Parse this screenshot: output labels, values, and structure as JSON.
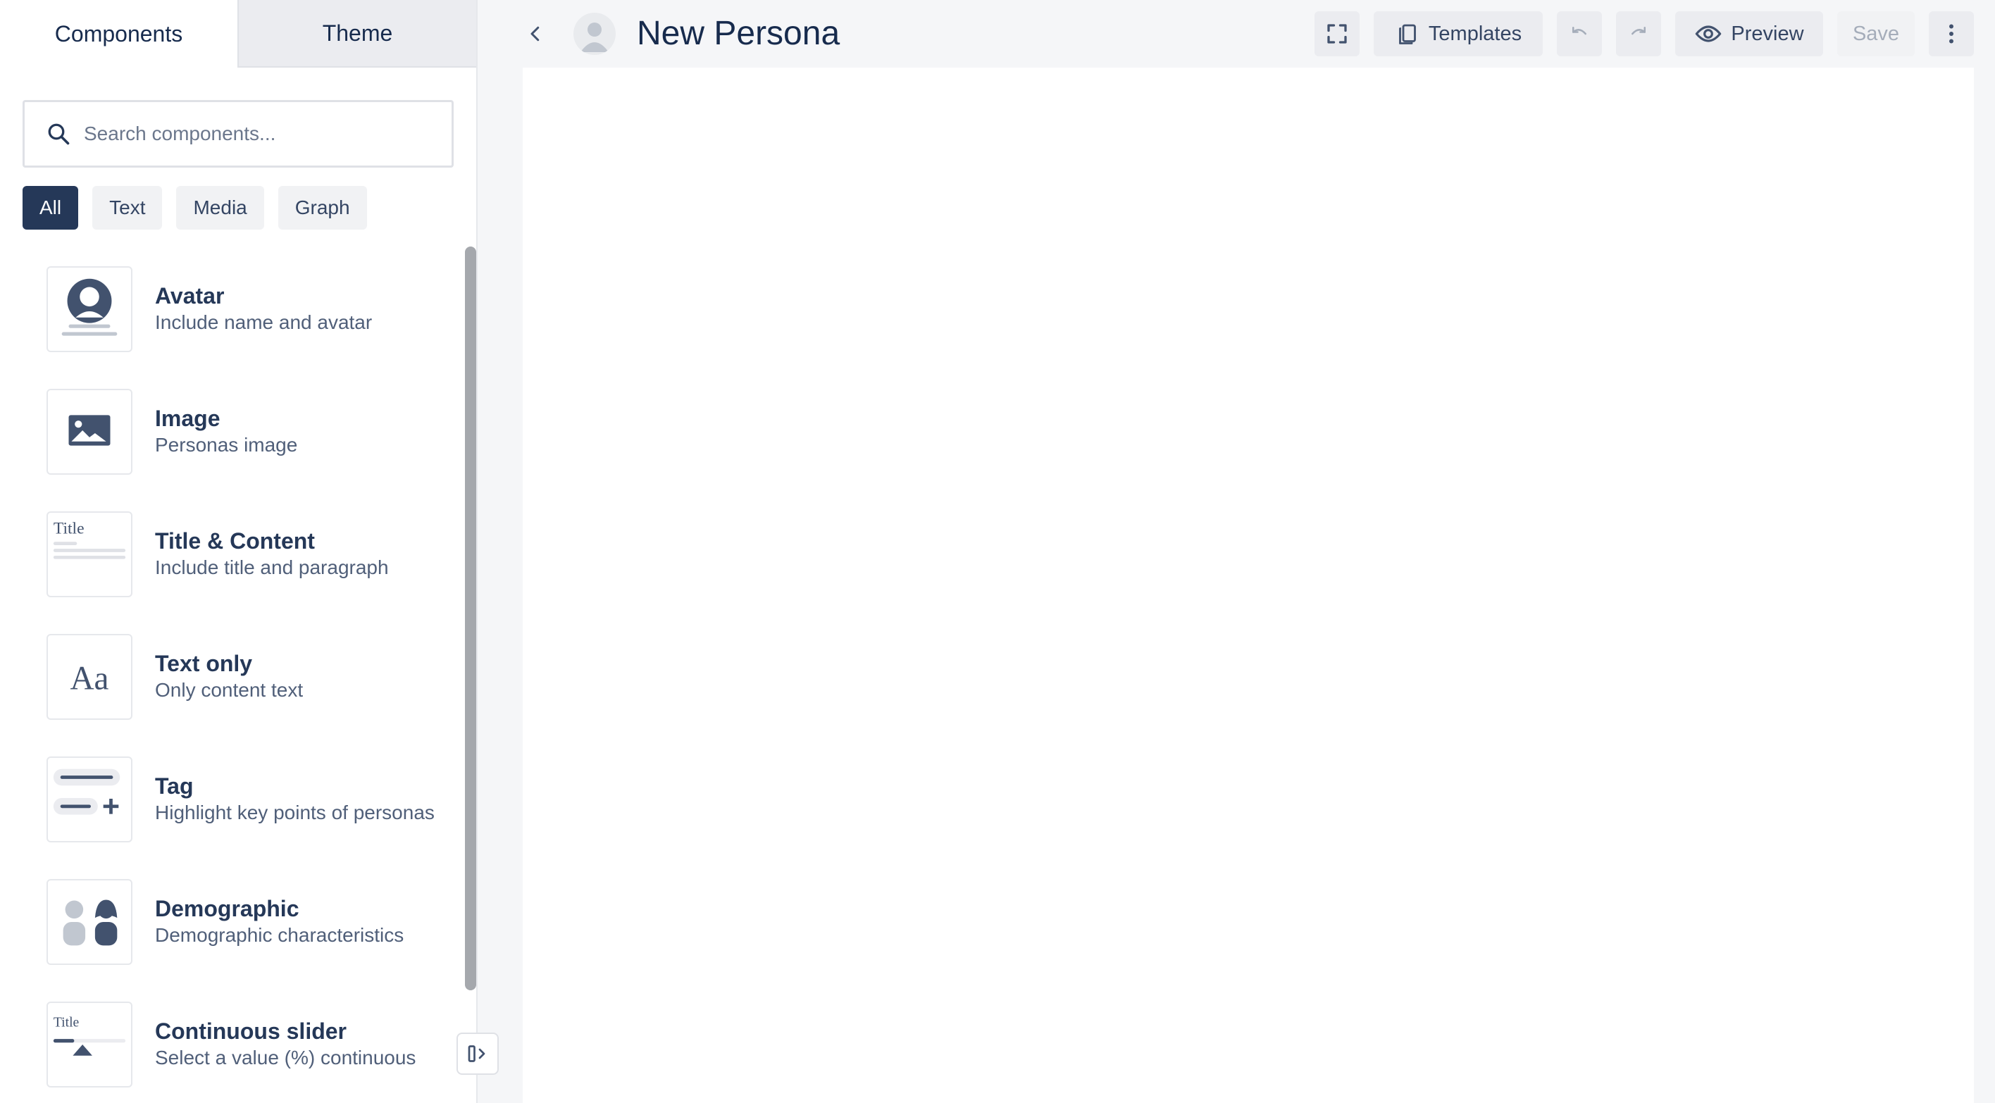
{
  "sidebar": {
    "tabs": [
      {
        "label": "Components"
      },
      {
        "label": "Theme"
      }
    ],
    "search": {
      "placeholder": "Search components..."
    },
    "filters": [
      {
        "label": "All"
      },
      {
        "label": "Text"
      },
      {
        "label": "Media"
      },
      {
        "label": "Graph"
      }
    ],
    "components": [
      {
        "title": "Avatar",
        "description": "Include name and avatar",
        "icon": "avatar-thumb-icon"
      },
      {
        "title": "Image",
        "description": "Personas image",
        "icon": "image-thumb-icon"
      },
      {
        "title": "Title & Content",
        "description": "Include title and paragraph",
        "icon": "title-content-thumb-icon",
        "thumb_text": "Title"
      },
      {
        "title": "Text only",
        "description": "Only content text",
        "icon": "text-only-thumb-icon",
        "thumb_text": "Aa"
      },
      {
        "title": "Tag",
        "description": "Highlight key points of personas",
        "icon": "tag-thumb-icon"
      },
      {
        "title": "Demographic",
        "description": "Demographic characteristics",
        "icon": "demographic-thumb-icon"
      },
      {
        "title": "Continuous slider",
        "description": "Select a value (%) continuous",
        "icon": "slider-thumb-icon",
        "thumb_text": "Title"
      }
    ]
  },
  "header": {
    "title": "New Persona",
    "templates_label": "Templates",
    "preview_label": "Preview",
    "save_label": "Save"
  },
  "colors": {
    "accent": "#253858",
    "icon": "#42526e",
    "muted": "#a5adba"
  }
}
